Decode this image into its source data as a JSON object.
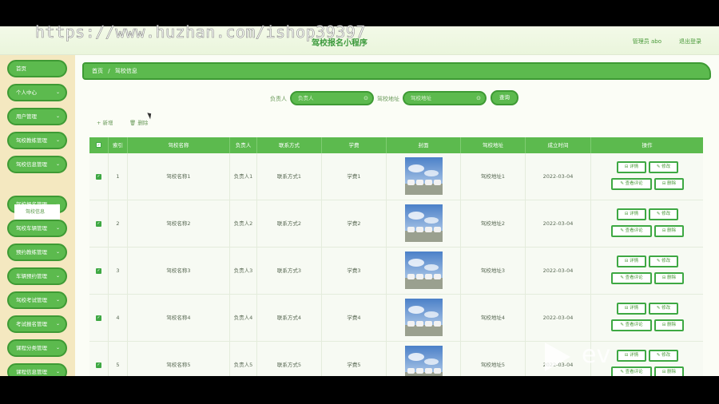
{
  "watermark": "https://www.huzhan.com/ishop39397",
  "header": {
    "title": "驾校报名小程序",
    "user": "管理员 abo",
    "logout": "退出登录"
  },
  "sidebar": {
    "items": [
      {
        "label": "首页",
        "chevron": false
      },
      {
        "label": "个人中心",
        "chevron": true
      },
      {
        "label": "用户管理",
        "chevron": true
      },
      {
        "label": "驾校教练管理",
        "chevron": true
      },
      {
        "label": "驾校信息管理",
        "chevron": true
      },
      {
        "label": "驾校报名管理",
        "chevron": true
      },
      {
        "label": "驾校车辆管理",
        "chevron": true
      },
      {
        "label": "预约教练管理",
        "chevron": true
      },
      {
        "label": "车辆预约管理",
        "chevron": true
      },
      {
        "label": "驾校考试管理",
        "chevron": true
      },
      {
        "label": "考试报名管理",
        "chevron": true
      },
      {
        "label": "课程分类管理",
        "chevron": true
      },
      {
        "label": "课程信息管理",
        "chevron": true
      }
    ],
    "submenu": "驾校信息"
  },
  "breadcrumb": {
    "home": "首页",
    "sep": "/",
    "current": "驾校信息"
  },
  "search": {
    "manager_label": "负责人",
    "manager_placeholder": "负责人",
    "address_label": "驾校地址",
    "address_placeholder": "驾校地址",
    "query_button": "查询"
  },
  "toolbar": {
    "add": "+ 新增",
    "delete": "删除"
  },
  "table": {
    "headers": [
      "索引",
      "驾校名称",
      "负责人",
      "联系方式",
      "学费",
      "封面",
      "驾校地址",
      "成立时间",
      "操作"
    ],
    "rows": [
      {
        "index": "1",
        "name": "驾校名称1",
        "manager": "负责人1",
        "contact": "联系方式1",
        "fee": "学费1",
        "address": "驾校地址1",
        "date": "2022-03-04"
      },
      {
        "index": "2",
        "name": "驾校名称2",
        "manager": "负责人2",
        "contact": "联系方式2",
        "fee": "学费2",
        "address": "驾校地址2",
        "date": "2022-03-04"
      },
      {
        "index": "3",
        "name": "驾校名称3",
        "manager": "负责人3",
        "contact": "联系方式3",
        "fee": "学费3",
        "address": "驾校地址3",
        "date": "2022-03-04"
      },
      {
        "index": "4",
        "name": "驾校名称4",
        "manager": "负责人4",
        "contact": "联系方式4",
        "fee": "学费4",
        "address": "驾校地址4",
        "date": "2022-03-04"
      },
      {
        "index": "5",
        "name": "驾校名称5",
        "manager": "负责人5",
        "contact": "联系方式5",
        "fee": "学费5",
        "address": "驾校地址5",
        "date": "2022-03-04"
      }
    ],
    "ops": {
      "detail": "详情",
      "edit": "修改",
      "review": "查看评论",
      "delete": "删除"
    }
  },
  "overlay_logo": "ev",
  "colors": {
    "accent": "#5cba4e",
    "accent_dark": "#3e9a34",
    "sidebar_bg": "#f4e8c0"
  }
}
